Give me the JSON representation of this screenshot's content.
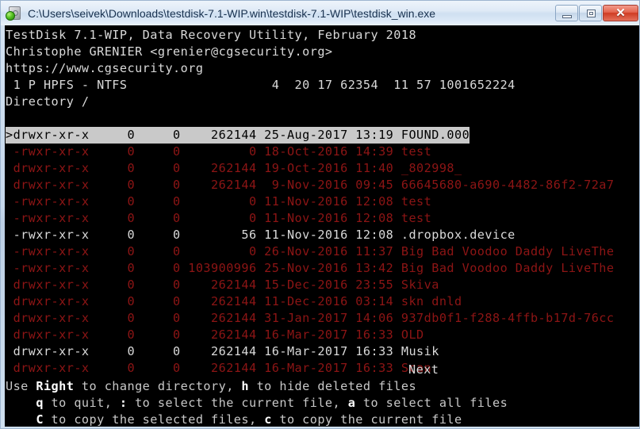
{
  "window": {
    "title": "C:\\Users\\seivek\\Downloads\\testdisk-7.1-WIP.win\\testdisk-7.1-WIP\\testdisk_win.exe",
    "icon": "disk-app-icon",
    "buttons": {
      "minimize": "minimize-button",
      "maximize": "maximize-button",
      "close_glyph": "✕"
    }
  },
  "console": {
    "header": {
      "line1": "TestDisk 7.1-WIP, Data Recovery Utility, February 2018",
      "line2": "Christophe GRENIER <grenier@cgsecurity.org>",
      "line3": "https://www.cgsecurity.org",
      "partition": " 1 P HPFS - NTFS                   4  20 17 62354  11 57 1001652224",
      "directory": "Directory /"
    },
    "rows": [
      {
        "perms": ">drwxr-xr-x",
        "uid": "0",
        "gid": "0",
        "size": "262144",
        "date": "25-Aug-2017",
        "time": "13:19",
        "name": "FOUND.000",
        "state": "selected",
        "text": ">drwxr-xr-x     0     0    262144 25-Aug-2017 13:19 FOUND.000"
      },
      {
        "perms": " -rwxr-xr-x",
        "uid": "0",
        "gid": "0",
        "size": "0",
        "date": "18-Oct-2016",
        "time": "14:39",
        "name": "test",
        "state": "deleted",
        "text": " -rwxr-xr-x     0     0         0 18-Oct-2016 14:39 test"
      },
      {
        "perms": " drwxr-xr-x",
        "uid": "0",
        "gid": "0",
        "size": "262144",
        "date": "19-Oct-2016",
        "time": "11:40",
        "name": "_802998_",
        "state": "deleted",
        "text": " drwxr-xr-x     0     0    262144 19-Oct-2016 11:40 _802998_"
      },
      {
        "perms": " drwxr-xr-x",
        "uid": "0",
        "gid": "0",
        "size": "262144",
        "date": "9-Nov-2016",
        "time": "09:45",
        "name": "66645680-a690-4482-86f2-72a7",
        "state": "deleted",
        "text": " drwxr-xr-x     0     0    262144  9-Nov-2016 09:45 66645680-a690-4482-86f2-72a7"
      },
      {
        "perms": " -rwxr-xr-x",
        "uid": "0",
        "gid": "0",
        "size": "0",
        "date": "11-Nov-2016",
        "time": "12:08",
        "name": "test",
        "state": "deleted",
        "text": " -rwxr-xr-x     0     0         0 11-Nov-2016 12:08 test"
      },
      {
        "perms": " -rwxr-xr-x",
        "uid": "0",
        "gid": "0",
        "size": "0",
        "date": "11-Nov-2016",
        "time": "12:08",
        "name": "test",
        "state": "deleted",
        "text": " -rwxr-xr-x     0     0         0 11-Nov-2016 12:08 test"
      },
      {
        "perms": " -rwxr-xr-x",
        "uid": "0",
        "gid": "0",
        "size": "56",
        "date": "11-Nov-2016",
        "time": "12:08",
        "name": ".dropbox.device",
        "state": "normal",
        "text": " -rwxr-xr-x     0     0        56 11-Nov-2016 12:08 .dropbox.device"
      },
      {
        "perms": " -rwxr-xr-x",
        "uid": "0",
        "gid": "0",
        "size": "0",
        "date": "26-Nov-2016",
        "time": "11:37",
        "name": "Big Bad Voodoo Daddy LiveThe",
        "state": "deleted",
        "text": " -rwxr-xr-x     0     0         0 26-Nov-2016 11:37 Big Bad Voodoo Daddy LiveThe"
      },
      {
        "perms": " -rwxr-xr-x",
        "uid": "0",
        "gid": "0",
        "size": "103900996",
        "date": "25-Nov-2016",
        "time": "13:42",
        "name": "Big Bad Voodoo Daddy LiveThe",
        "state": "deleted",
        "text": " -rwxr-xr-x     0     0 103900996 25-Nov-2016 13:42 Big Bad Voodoo Daddy LiveThe"
      },
      {
        "perms": " drwxr-xr-x",
        "uid": "0",
        "gid": "0",
        "size": "262144",
        "date": "15-Dec-2016",
        "time": "23:55",
        "name": "Skiva",
        "state": "deleted",
        "text": " drwxr-xr-x     0     0    262144 15-Dec-2016 23:55 Skiva"
      },
      {
        "perms": " drwxr-xr-x",
        "uid": "0",
        "gid": "0",
        "size": "262144",
        "date": "11-Dec-2016",
        "time": "03:14",
        "name": "skn dnld",
        "state": "deleted",
        "text": " drwxr-xr-x     0     0    262144 11-Dec-2016 03:14 skn dnld"
      },
      {
        "perms": " drwxr-xr-x",
        "uid": "0",
        "gid": "0",
        "size": "262144",
        "date": "31-Jan-2017",
        "time": "14:06",
        "name": "937db0f1-f288-4ffb-b17d-76cc",
        "state": "deleted",
        "text": " drwxr-xr-x     0     0    262144 31-Jan-2017 14:06 937db0f1-f288-4ffb-b17d-76cc"
      },
      {
        "perms": " drwxr-xr-x",
        "uid": "0",
        "gid": "0",
        "size": "262144",
        "date": "16-Mar-2017",
        "time": "16:33",
        "name": "OLD",
        "state": "deleted",
        "text": " drwxr-xr-x     0     0    262144 16-Mar-2017 16:33 OLD"
      },
      {
        "perms": " drwxr-xr-x",
        "uid": "0",
        "gid": "0",
        "size": "262144",
        "date": "16-Mar-2017",
        "time": "16:33",
        "name": "Musik",
        "state": "normal",
        "text": " drwxr-xr-x     0     0    262144 16-Mar-2017 16:33 Musik"
      },
      {
        "perms": " drwxr-xr-x",
        "uid": "0",
        "gid": "0",
        "size": "262144",
        "date": "16-Mar-2017",
        "time": "16:33",
        "name": "Scan",
        "state": "deleted",
        "text": " drwxr-xr-x     0     0    262144 16-Mar-2017 16:33 Scan"
      }
    ],
    "next_label": "Next",
    "help": {
      "line1_pre": "Use ",
      "line1_key": "Right",
      "line1_mid": " to change directory, ",
      "line1_key2": "h",
      "line1_post": " to hide deleted files",
      "line2_pre": "    ",
      "line2_key": "q",
      "line2_mid": " to quit, ",
      "line2_key2": ":",
      "line2_mid2": " to select the current file, ",
      "line2_key3": "a",
      "line2_post": " to select all files",
      "line3_pre": "    ",
      "line3_key": "C",
      "line3_mid": " to copy the selected files, ",
      "line3_key2": "c",
      "line3_post": " to copy the current file"
    }
  },
  "colors": {
    "console_bg": "#000000",
    "text_white": "#d9d9d9",
    "text_deleted_red": "#8d1515",
    "selection_bg": "#c9c9c9",
    "selection_fg": "#000000",
    "titlebar_text": "#18314f"
  }
}
